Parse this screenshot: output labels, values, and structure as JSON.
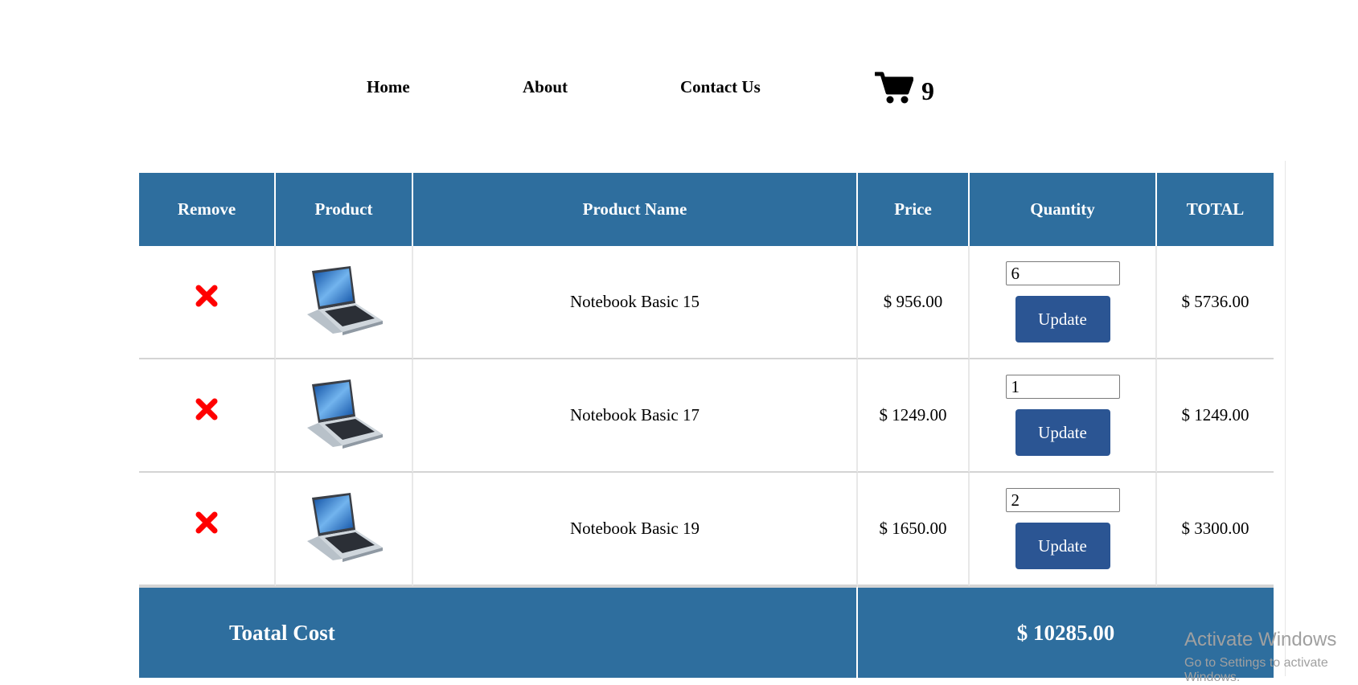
{
  "nav": {
    "home": "Home",
    "about": "About",
    "contact": "Contact Us",
    "cart_count": "9",
    "cart_icon": "shopping-cart-icon"
  },
  "table": {
    "headers": [
      "Remove",
      "Product",
      "Product Name",
      "Price",
      "Quantity",
      "TOTAL"
    ],
    "rows": [
      {
        "name": "Notebook Basic 15",
        "price": "$ 956.00",
        "quantity": "6",
        "total": "$ 5736.00",
        "update_label": "Update"
      },
      {
        "name": "Notebook Basic 17",
        "price": "$ 1249.00",
        "quantity": "1",
        "total": "$ 1249.00",
        "update_label": "Update"
      },
      {
        "name": "Notebook Basic 19",
        "price": "$ 1650.00",
        "quantity": "2",
        "total": "$ 3300.00",
        "update_label": "Update"
      }
    ],
    "footer": {
      "label": "Toatal Cost",
      "value": "$ 10285.00"
    }
  },
  "icons": {
    "remove": "remove-x-icon",
    "product": "laptop-image"
  },
  "colors": {
    "header_bg": "#2e6e9e",
    "button_bg": "#2b5593",
    "remove": "#ff0000"
  },
  "watermark": {
    "line1": "Activate Windows",
    "line2": "Go to Settings to activate Windows."
  }
}
